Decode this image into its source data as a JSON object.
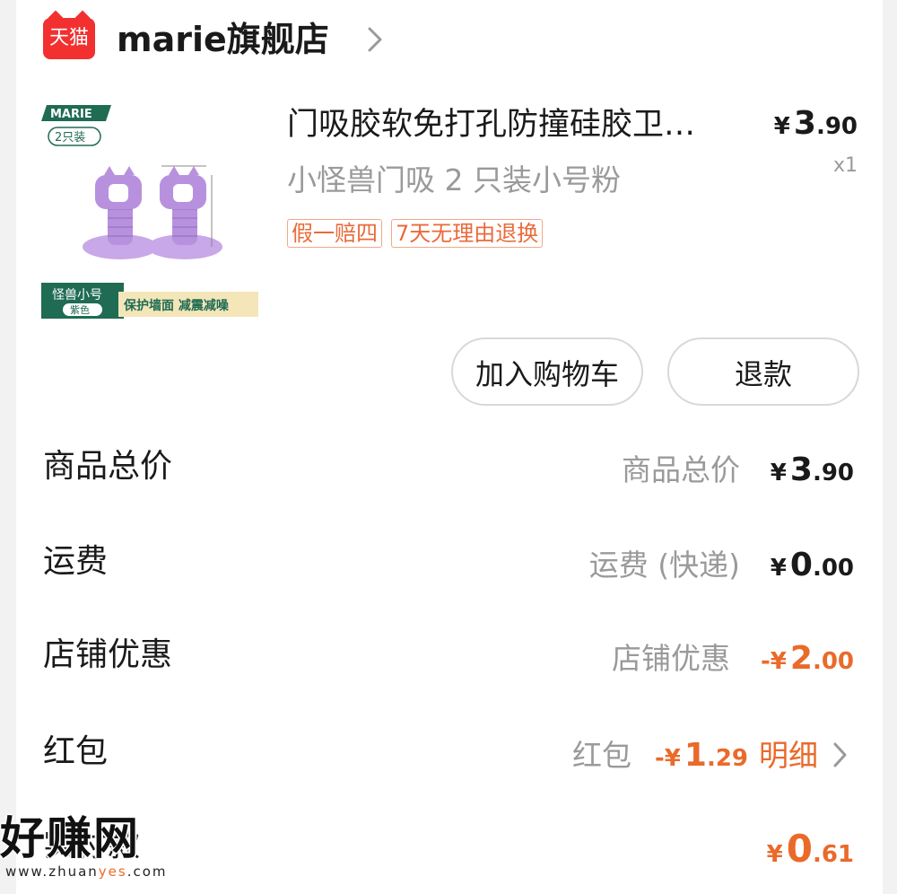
{
  "header": {
    "platform_logo_text": "天猫",
    "shop_name": "marie旗舰店"
  },
  "product": {
    "image_alt": "MARIE 2只装 门吸 怪兽小号 紫色 保护墙面 减震减噪",
    "image_texts": {
      "brand": "MARIE",
      "pack": "2只装",
      "model": "怪兽小号",
      "color": "紫色",
      "slogan": "保护墙面 减震减噪"
    },
    "title": "门吸胶软免打孔防撞硅胶卫…",
    "spec": "小怪兽门吸 2 只装小号粉",
    "price_currency": "¥",
    "price_int": "3",
    "price_dec": ".90",
    "quantity": "x1",
    "tags": [
      "假一赔四",
      "7天无理由退换"
    ]
  },
  "actions": {
    "add_to_cart": "加入购物车",
    "refund": "退款"
  },
  "summary": {
    "goods_total": {
      "label": "商品总价",
      "sub": "商品总价",
      "cur": "¥",
      "int": "3",
      "dec": ".90"
    },
    "shipping": {
      "label": "运费",
      "sub": "运费 (快递)",
      "cur": "¥",
      "int": "0",
      "dec": ".00"
    },
    "shop_discount": {
      "label": "店铺优惠",
      "sub": "店铺优惠",
      "cur": "-¥",
      "int": "2",
      "dec": ".00"
    },
    "red_packet": {
      "label": "红包",
      "sub": "红包",
      "cur": "-¥",
      "int": "1",
      "dec": ".29",
      "detail": "明细"
    },
    "paid": {
      "label": "实付款",
      "cur": "¥",
      "int": "0",
      "dec": ".61"
    }
  },
  "watermark": {
    "site_name": "好赚网",
    "url_prefix": "www.zhuan",
    "url_highlight": "yes",
    "url_suffix": ".com"
  },
  "colors": {
    "accent_orange": "#ea6a2a",
    "tmall_red": "#f23030",
    "muted_text": "#9a9a9a"
  }
}
